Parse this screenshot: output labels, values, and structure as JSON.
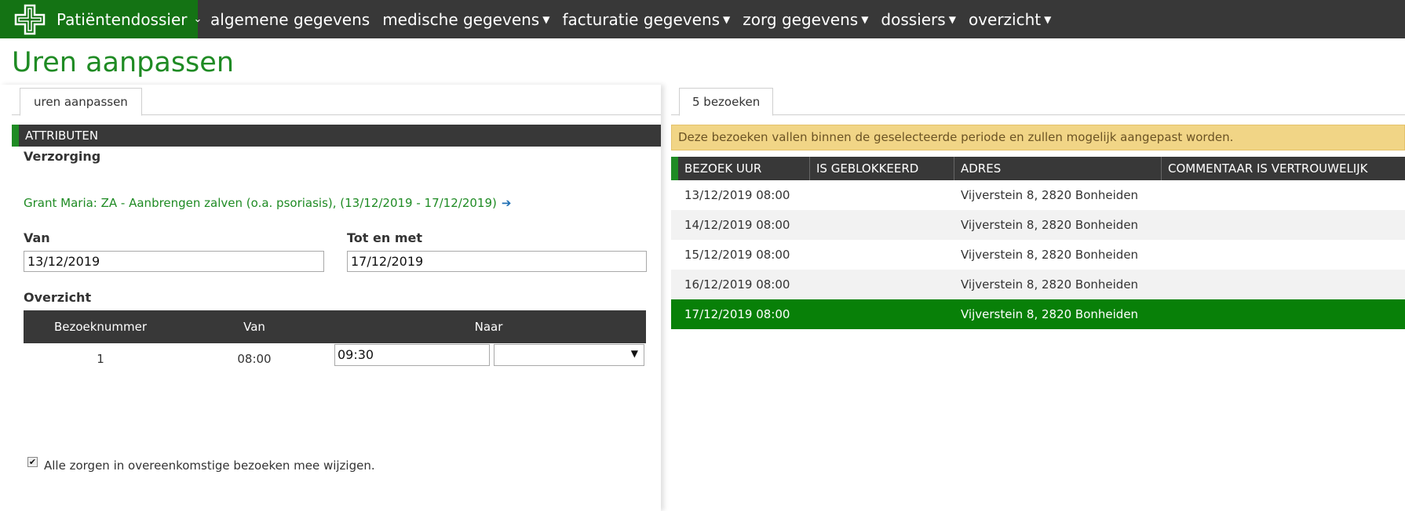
{
  "nav": {
    "brand": "Patiëntendossier",
    "items": [
      {
        "label": "algemene gegevens",
        "has_dropdown": false
      },
      {
        "label": "medische gegevens",
        "has_dropdown": true
      },
      {
        "label": "facturatie gegevens",
        "has_dropdown": true
      },
      {
        "label": "zorg gegevens",
        "has_dropdown": true
      },
      {
        "label": "dossiers",
        "has_dropdown": true
      },
      {
        "label": "overzicht",
        "has_dropdown": true
      }
    ],
    "caret": "▼"
  },
  "page": {
    "title": "Uren aanpassen"
  },
  "left": {
    "tab": "uren aanpassen",
    "section": "ATTRIBUTEN",
    "verzorging_label": "Verzorging",
    "verzorging_value": "Grant Maria: ZA - Aanbrengen zalven (o.a. psoriasis), (13/12/2019 - 17/12/2019)",
    "arrow": "➔",
    "van_label": "Van",
    "van_value": "13/12/2019",
    "tot_label": "Tot en met",
    "tot_value": "17/12/2019",
    "overzicht_label": "Overzicht",
    "table": {
      "headers": [
        "Bezoeknummer",
        "Van",
        "Naar"
      ],
      "row": {
        "nummer": "1",
        "van": "08:00",
        "naar": "09:30",
        "select_value": ""
      }
    },
    "checkbox_label": "Alle zorgen in overeenkomstige bezoeken mee wijzigen.",
    "checkbox_checked": true
  },
  "right": {
    "tab": "5 bezoeken",
    "warning": "Deze bezoeken vallen binnen de geselecteerde periode en zullen mogelijk aangepast worden.",
    "headers": [
      "BEZOEK UUR",
      "IS GEBLOKKEERD",
      "ADRES",
      "COMMENTAAR IS VERTROUWELIJK"
    ],
    "rows": [
      {
        "uur": "13/12/2019 08:00",
        "geblokkeerd": "",
        "adres": "Vijverstein 8, 2820 Bonheiden",
        "commentaar": ""
      },
      {
        "uur": "14/12/2019 08:00",
        "geblokkeerd": "",
        "adres": "Vijverstein 8, 2820 Bonheiden",
        "commentaar": ""
      },
      {
        "uur": "15/12/2019 08:00",
        "geblokkeerd": "",
        "adres": "Vijverstein 8, 2820 Bonheiden",
        "commentaar": ""
      },
      {
        "uur": "16/12/2019 08:00",
        "geblokkeerd": "",
        "adres": "Vijverstein 8, 2820 Bonheiden",
        "commentaar": ""
      },
      {
        "uur": "17/12/2019 08:00",
        "geblokkeerd": "",
        "adres": "Vijverstein 8, 2820 Bonheiden",
        "commentaar": ""
      }
    ],
    "selected_row": 4
  },
  "colors": {
    "accent": "#1f8b24",
    "navbar": "#383838",
    "brand": "#147314",
    "selected_row": "#088008",
    "warning_bg": "#f1d586"
  }
}
